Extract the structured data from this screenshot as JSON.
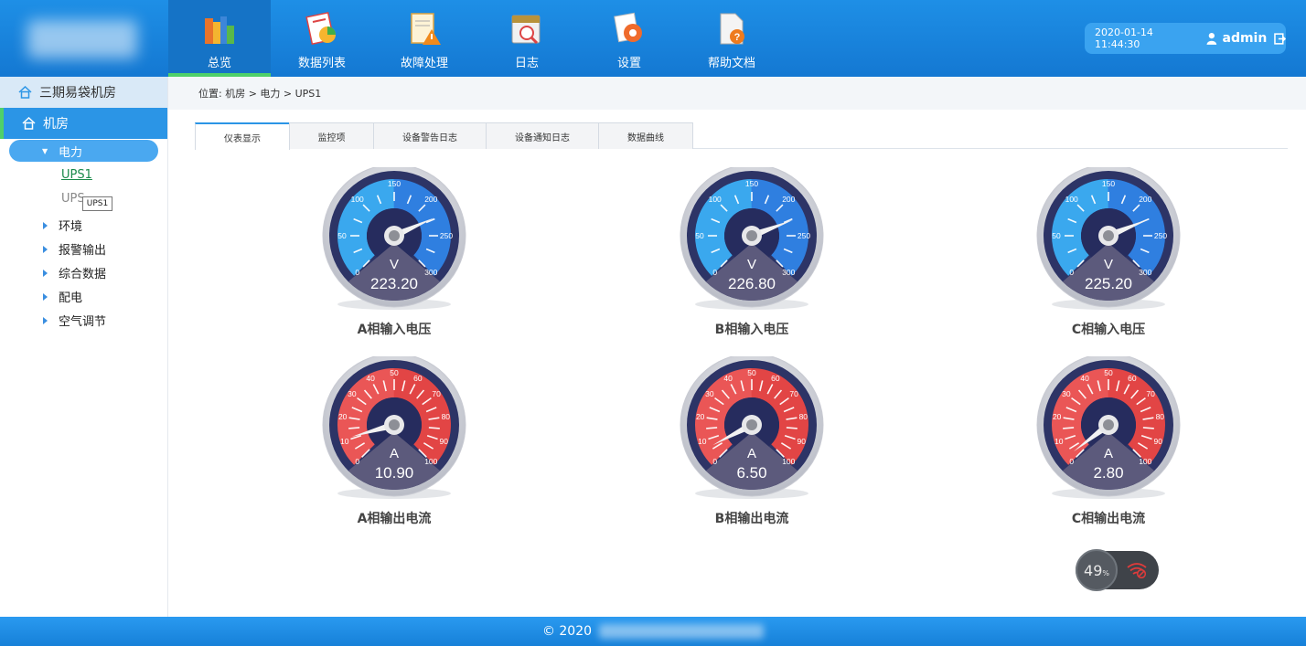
{
  "nav": {
    "items": [
      {
        "label": "总览",
        "icon": "overview-books-icon"
      },
      {
        "label": "数据列表",
        "icon": "data-list-icon"
      },
      {
        "label": "故障处理",
        "icon": "fault-warning-icon"
      },
      {
        "label": "日志",
        "icon": "calendar-log-icon"
      },
      {
        "label": "设置",
        "icon": "settings-gear-icon"
      },
      {
        "label": "帮助文档",
        "icon": "help-document-icon"
      }
    ],
    "active": "总览"
  },
  "user": {
    "datetime": "2020-01-14  11:44:30",
    "name": "admin"
  },
  "sidebar": {
    "site": "三期易袋机房",
    "room": "机房",
    "power": "电力",
    "ups1": "UPS1",
    "ups2": "UPS",
    "tooltip": "UPS1",
    "nodes": [
      "环境",
      "报警输出",
      "综合数据",
      "配电",
      "空气调节"
    ]
  },
  "breadcrumb": "位置:  机房 > 电力 > UPS1",
  "tabs": [
    "仪表显示",
    "监控项",
    "设备警告日志",
    "设备通知日志",
    "数据曲线"
  ],
  "gauges": {
    "voltage_ticks": [
      "0",
      "50",
      "100",
      "150",
      "200",
      "250",
      "300"
    ],
    "current_ticks": [
      "0",
      "10",
      "20",
      "30",
      "40",
      "50",
      "60",
      "70",
      "80",
      "90",
      "100"
    ],
    "voltage_unit": "V",
    "current_unit": "A",
    "items": [
      {
        "title": "A相输入电压",
        "value": "223.20",
        "num": 223.2,
        "kind": "voltage"
      },
      {
        "title": "B相输入电压",
        "value": "226.80",
        "num": 226.8,
        "kind": "voltage"
      },
      {
        "title": "C相输入电压",
        "value": "225.20",
        "num": 225.2,
        "kind": "voltage"
      },
      {
        "title": "A相输出电流",
        "value": "10.90",
        "num": 10.9,
        "kind": "current"
      },
      {
        "title": "B相输出电流",
        "value": "6.50",
        "num": 6.5,
        "kind": "current"
      },
      {
        "title": "C相输出电流",
        "value": "2.80",
        "num": 2.8,
        "kind": "current"
      }
    ]
  },
  "network": {
    "percent": "49",
    "unit": "%"
  },
  "footer": {
    "text": "© 2020"
  },
  "colors": {
    "primary": "#1e8fe6",
    "accent_green": "#4fd06a",
    "voltage_arc": "#3aa8ee",
    "current_arc": "#e85a5a"
  }
}
